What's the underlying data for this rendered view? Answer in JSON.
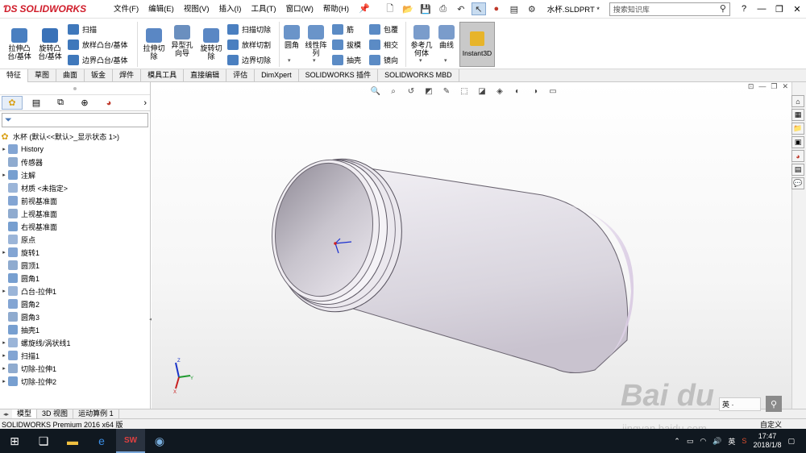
{
  "app": {
    "logo_text": "SOLIDWORKS",
    "doc_name": "水杯.SLDPRT *",
    "search_placeholder": "搜索知识库"
  },
  "menu": [
    "文件(F)",
    "编辑(E)",
    "视图(V)",
    "插入(I)",
    "工具(T)",
    "窗口(W)",
    "帮助(H)"
  ],
  "ribbon": {
    "extrude_boss": "拉伸凸\n台/基体",
    "revolve_boss": "旋转凸\n台/基体",
    "sweep": "扫描",
    "loft_boss": "放样凸台/基体",
    "boundary_boss": "边界凸台/基体",
    "extrude_cut": "拉伸切\n除",
    "hole_wizard": "异型孔\n向导",
    "revolve_cut": "旋转切\n除",
    "sweep_cut": "扫描切除",
    "loft_cut": "放样切割",
    "boundary_cut": "边界切除",
    "fillet": "圆角",
    "linear_pattern": "线性阵\n列",
    "rib": "筋",
    "draft": "拔模",
    "shell": "抽壳",
    "wrap": "包覆",
    "intersect": "相交",
    "mirror": "镜向",
    "ref_geometry": "参考几\n何体",
    "curves": "曲线",
    "instant3d": "Instant3D"
  },
  "tabs": [
    "特征",
    "草图",
    "曲面",
    "钣金",
    "焊件",
    "模具工具",
    "直接编辑",
    "评估",
    "DimXpert",
    "SOLIDWORKS 插件",
    "SOLIDWORKS MBD"
  ],
  "tree": {
    "root": "水杯  (默认<<默认>_显示状态 1>)",
    "items": [
      {
        "label": "History",
        "exp": true
      },
      {
        "label": "传感器",
        "exp": false
      },
      {
        "label": "注解",
        "exp": true
      },
      {
        "label": "材质 <未指定>",
        "exp": false
      },
      {
        "label": "前视基准面",
        "exp": false
      },
      {
        "label": "上视基准面",
        "exp": false
      },
      {
        "label": "右视基准面",
        "exp": false
      },
      {
        "label": "原点",
        "exp": false
      },
      {
        "label": "旋转1",
        "exp": true
      },
      {
        "label": "圆顶1",
        "exp": false
      },
      {
        "label": "圆角1",
        "exp": false
      },
      {
        "label": "凸台-拉伸1",
        "exp": true
      },
      {
        "label": "圆角2",
        "exp": false
      },
      {
        "label": "圆角3",
        "exp": false
      },
      {
        "label": "抽壳1",
        "exp": false
      },
      {
        "label": "螺旋线/涡状线1",
        "exp": true
      },
      {
        "label": "扫描1",
        "exp": true
      },
      {
        "label": "切除-拉伸1",
        "exp": true
      },
      {
        "label": "切除-拉伸2",
        "exp": true
      }
    ]
  },
  "bottom_tabs": [
    "模型",
    "3D 视图",
    "运动算例 1"
  ],
  "status": {
    "left": "SOLIDWORKS Premium 2016 x64 版",
    "right": "自定义"
  },
  "taskbar": {
    "time": "17:47",
    "date": "2018/1/8",
    "ime": "英"
  },
  "watermark": {
    "main": "Bai du",
    "sub": "jingyan.baidu.com",
    "search_hint": "英 ·"
  },
  "colors": {
    "brand": "#d01c2a",
    "part": "#e4e0ea",
    "taskbar": "#101820"
  }
}
